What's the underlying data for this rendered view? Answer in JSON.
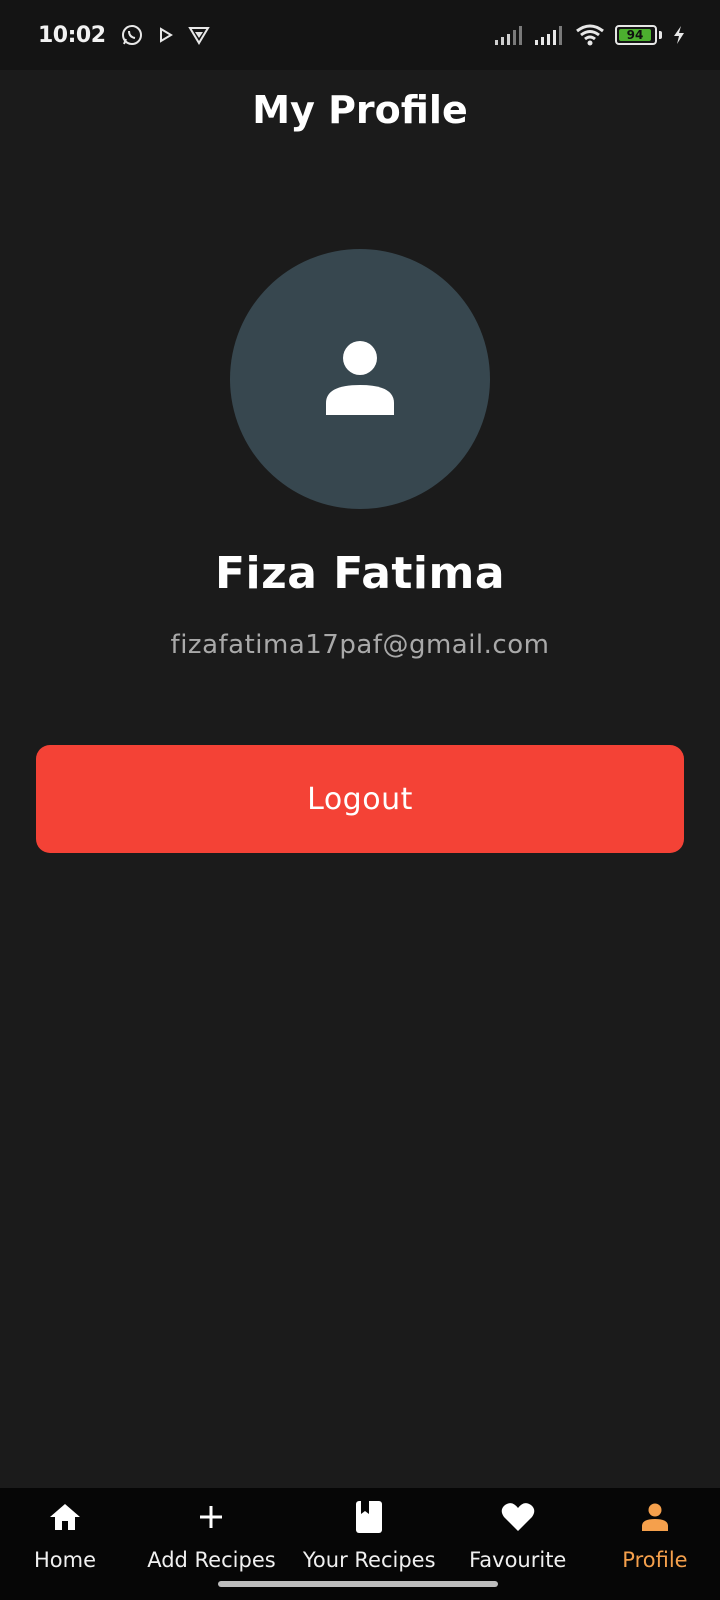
{
  "status_bar": {
    "time": "10:02",
    "battery_level": "94",
    "battery_fraction": 0.94,
    "icons": [
      "whatsapp-icon",
      "play-icon",
      "vpn-icon",
      "signal-icon",
      "signal-icon",
      "wifi-icon",
      "battery-icon",
      "charging-icon"
    ]
  },
  "header": {
    "title": "My Profile"
  },
  "profile": {
    "name": "Fiza Fatima",
    "email": "fizafatima17paf@gmail.com",
    "avatar_icon": "person-icon"
  },
  "actions": {
    "logout_label": "Logout"
  },
  "bottom_nav": {
    "items": [
      {
        "label": "Home",
        "icon": "home-icon"
      },
      {
        "label": "Add Recipes",
        "icon": "plus-icon"
      },
      {
        "label": "Your Recipes",
        "icon": "book-icon"
      },
      {
        "label": "Favourite",
        "icon": "heart-icon"
      },
      {
        "label": "Profile",
        "icon": "person-icon",
        "active": true
      }
    ]
  },
  "colors": {
    "background": "#1b1b1b",
    "avatar_bg": "#37474f",
    "logout_bg": "#f44236",
    "active_nav": "#f5a04c",
    "inactive_nav": "#f0f0f0"
  }
}
